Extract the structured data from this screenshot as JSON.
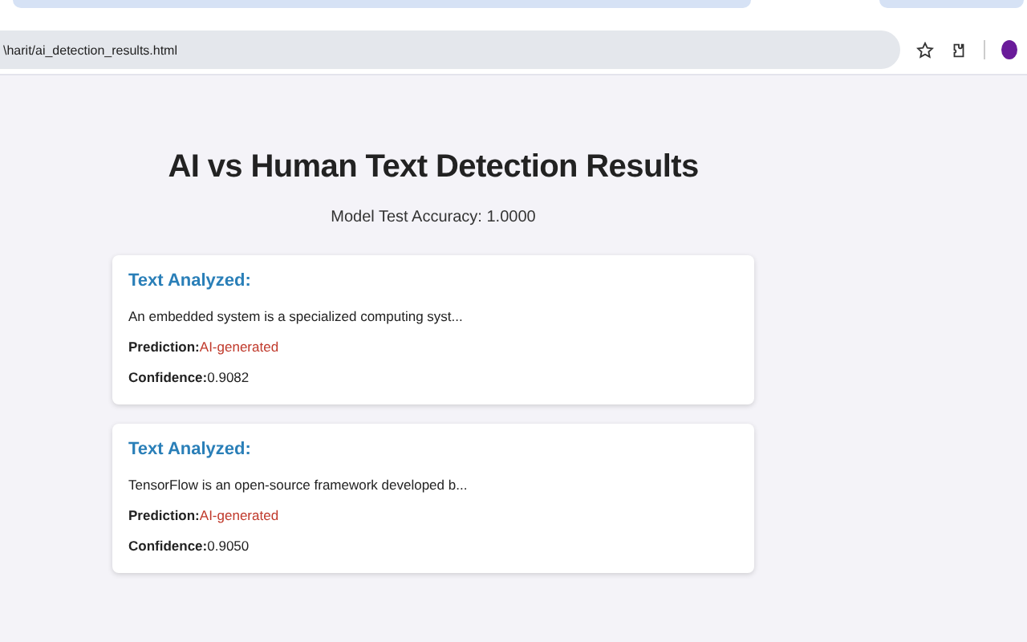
{
  "browser": {
    "url": "\\harit/ai_detection_results.html"
  },
  "page": {
    "title": "AI vs Human Text Detection Results",
    "accuracy": "Model Test Accuracy: 1.0000"
  },
  "results": [
    {
      "heading": "Text Analyzed:",
      "text": "An embedded system is a specialized computing syst...",
      "prediction_label": "Prediction:",
      "prediction": "AI-generated",
      "confidence_label": "Confidence:",
      "confidence": "0.9082"
    },
    {
      "heading": "Text Analyzed:",
      "text": "TensorFlow is an open-source framework developed b...",
      "prediction_label": "Prediction:",
      "prediction": "AI-generated",
      "confidence_label": "Confidence:",
      "confidence": "0.9050"
    }
  ]
}
